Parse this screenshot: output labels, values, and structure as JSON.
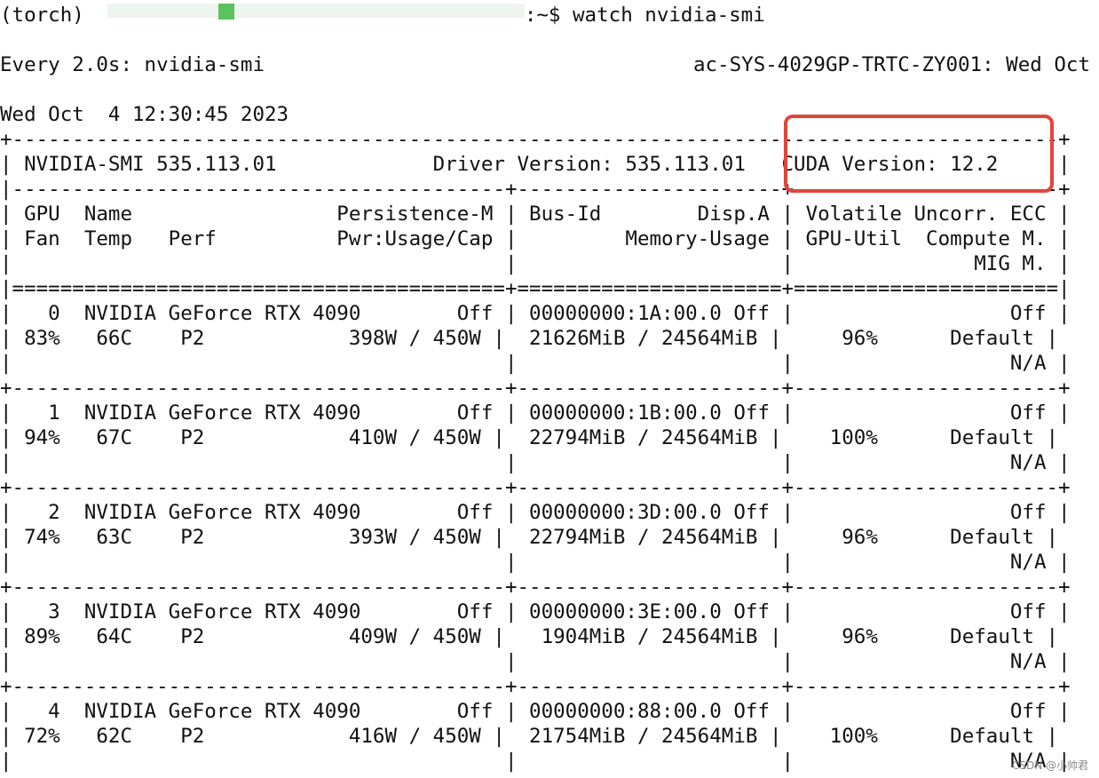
{
  "terminal": {
    "prompt_env": "(torch)",
    "prompt_suffix": ":~$",
    "command": "watch nvidia-smi",
    "watch_header_left": "Every 2.0s: nvidia-smi",
    "watch_header_right": "ac-SYS-4029GP-TRTC-ZY001: Wed Oct",
    "timestamp": "Wed Oct  4 12:30:45 2023"
  },
  "smi": {
    "version_line": "| NVIDIA-SMI 535.113.01             Driver Version: 535.113.01   CUDA Version: 12.2     |",
    "border_top": "+---------------------------------------------------------------------------------------+",
    "border_header_sep": "|-----------------------------------------+----------------------+----------------------+",
    "header_lines": [
      "| GPU  Name                 Persistence-M | Bus-Id        Disp.A | Volatile Uncorr. ECC |",
      "| Fan  Temp   Perf          Pwr:Usage/Cap |         Memory-Usage | GPU-Util  Compute M. |",
      "|                                         |                      |               MIG M. |"
    ],
    "border_double": "|=========================================+======================+======================|",
    "border_row_sep": "+-----------------------------------------+----------------------+----------------------+",
    "gpus": [
      {
        "line1": "|   0  NVIDIA GeForce RTX 4090        Off | 00000000:1A:00.0 Off |                  Off |",
        "line2": "| 83%   66C    P2            398W / 450W |  21626MiB / 24564MiB |     96%      Default |",
        "line3": "|                                         |                      |                  N/A |"
      },
      {
        "line1": "|   1  NVIDIA GeForce RTX 4090        Off | 00000000:1B:00.0 Off |                  Off |",
        "line2": "| 94%   67C    P2            410W / 450W |  22794MiB / 24564MiB |    100%      Default |",
        "line3": "|                                         |                      |                  N/A |"
      },
      {
        "line1": "|   2  NVIDIA GeForce RTX 4090        Off | 00000000:3D:00.0 Off |                  Off |",
        "line2": "| 74%   63C    P2            393W / 450W |  22794MiB / 24564MiB |     96%      Default |",
        "line3": "|                                         |                      |                  N/A |"
      },
      {
        "line1": "|   3  NVIDIA GeForce RTX 4090        Off | 00000000:3E:00.0 Off |                  Off |",
        "line2": "| 89%   64C    P2            409W / 450W |   1904MiB / 24564MiB |     96%      Default |",
        "line3": "|                                         |                      |                  N/A |"
      },
      {
        "line1": "|   4  NVIDIA GeForce RTX 4090        Off | 00000000:88:00.0 Off |                  Off |",
        "line2": "| 72%   62C    P2            416W / 450W |  21754MiB / 24564MiB |    100%      Default |",
        "line3": "|                                         |                      |                  N/A |"
      }
    ]
  },
  "annotation": {
    "highlight_color": "#e2453a"
  },
  "watermark": "CSDN @小帅君"
}
